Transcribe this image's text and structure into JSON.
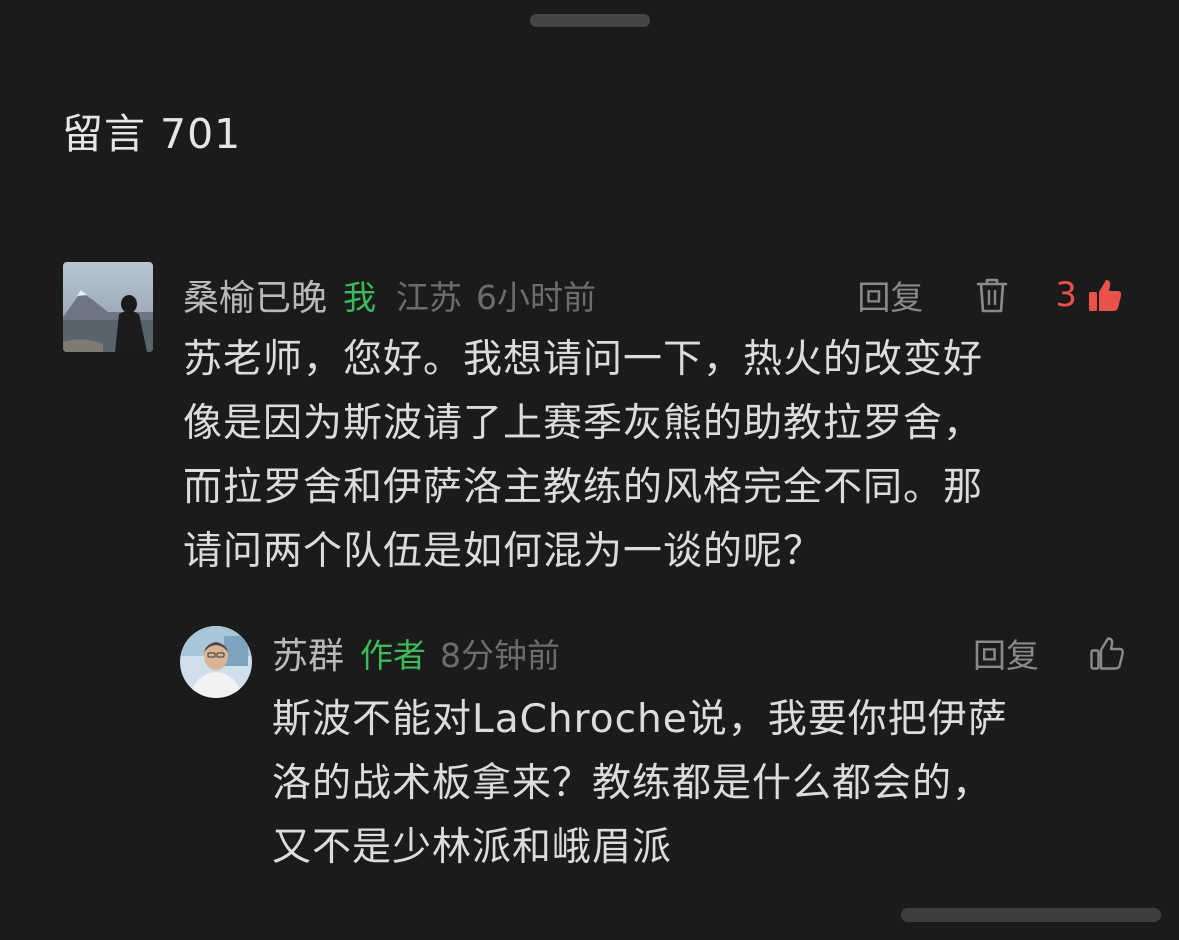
{
  "header": {
    "title": "留言",
    "count": "701"
  },
  "comments": [
    {
      "nickname": "桑榆已晚",
      "tag": "我",
      "location": "江苏",
      "time": "6小时前",
      "reply_label": "回复",
      "like_count": "3",
      "lines": [
        "苏老师，您好。我想请问一下，热火的改变好",
        "像是因为斯波请了上赛季灰熊的助教拉罗舍，",
        "而拉罗舍和伊萨洛主教练的风格完全不同。那",
        "请问两个队伍是如何混为一谈的呢？"
      ]
    },
    {
      "nickname": "苏群",
      "tag": "作者",
      "time": "8分钟前",
      "reply_label": "回复",
      "lines": [
        "斯波不能对LaChroche说，我要你把伊萨",
        "洛的战术板拿来？教练都是什么都会的，",
        "又不是少林派和峨眉派"
      ]
    }
  ],
  "colors": {
    "background": "#1b1b1b",
    "author_tag": "#3fb95a",
    "like_active": "#e8524a",
    "meta_gray": "#6c6c6c"
  },
  "icons": {
    "delete": "trash-icon",
    "like_active": "thumbs-up-filled-icon",
    "like": "thumbs-up-outline-icon"
  }
}
